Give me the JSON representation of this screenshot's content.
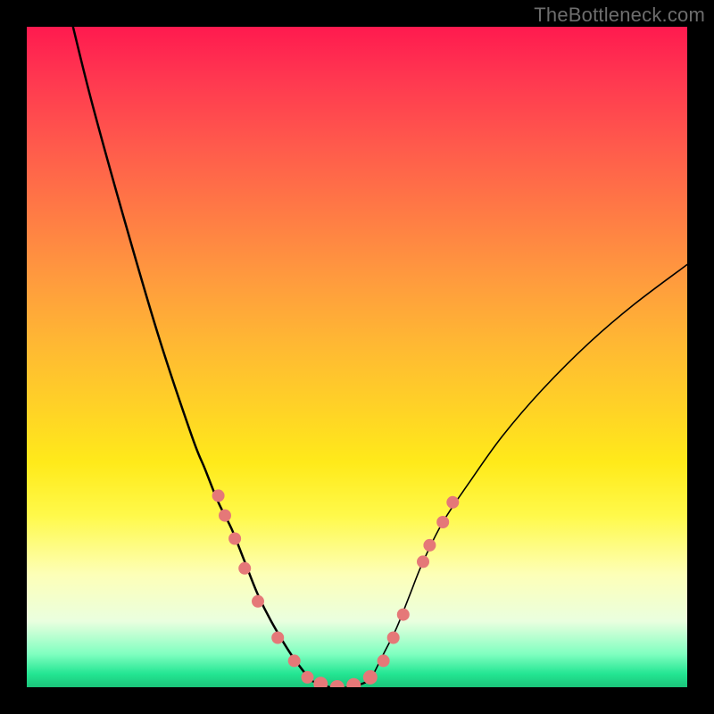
{
  "attribution": "TheBottleneck.com",
  "chart_data": {
    "type": "line",
    "title": "",
    "xlabel": "",
    "ylabel": "",
    "xlim": [
      0,
      100
    ],
    "ylim": [
      0,
      100
    ],
    "grid": false,
    "legend": false,
    "series": [
      {
        "name": "left-branch",
        "x": [
          7,
          10,
          15,
          20,
          25,
          27,
          29,
          31,
          33,
          35,
          37,
          40,
          43
        ],
        "y": [
          100,
          88,
          70,
          53,
          38,
          33,
          28,
          24,
          19,
          14,
          10,
          5,
          1
        ],
        "color": "#000000",
        "width": 2.5
      },
      {
        "name": "right-branch",
        "x": [
          52,
          54,
          56,
          58,
          60,
          63,
          67,
          72,
          78,
          85,
          92,
          100
        ],
        "y": [
          1,
          5,
          9,
          14,
          19,
          25,
          31,
          38,
          45,
          52,
          58,
          64
        ],
        "color": "#000000",
        "width": 1.6
      },
      {
        "name": "floor",
        "x": [
          43,
          46,
          49,
          52
        ],
        "y": [
          1,
          0,
          0,
          1
        ],
        "color": "#000000",
        "width": 2.2
      }
    ],
    "markers": [
      {
        "x": 29.0,
        "y": 29.0,
        "r": 7
      },
      {
        "x": 30.0,
        "y": 26.0,
        "r": 7
      },
      {
        "x": 31.5,
        "y": 22.5,
        "r": 7
      },
      {
        "x": 33.0,
        "y": 18.0,
        "r": 7
      },
      {
        "x": 35.0,
        "y": 13.0,
        "r": 7
      },
      {
        "x": 38.0,
        "y": 7.5,
        "r": 7
      },
      {
        "x": 40.5,
        "y": 4.0,
        "r": 7
      },
      {
        "x": 42.5,
        "y": 1.5,
        "r": 7
      },
      {
        "x": 44.5,
        "y": 0.5,
        "r": 8
      },
      {
        "x": 47.0,
        "y": 0.0,
        "r": 8
      },
      {
        "x": 49.5,
        "y": 0.3,
        "r": 8
      },
      {
        "x": 52.0,
        "y": 1.5,
        "r": 8
      },
      {
        "x": 54.0,
        "y": 4.0,
        "r": 7
      },
      {
        "x": 55.5,
        "y": 7.5,
        "r": 7
      },
      {
        "x": 57.0,
        "y": 11.0,
        "r": 7
      },
      {
        "x": 60.0,
        "y": 19.0,
        "r": 7
      },
      {
        "x": 61.0,
        "y": 21.5,
        "r": 7
      },
      {
        "x": 63.0,
        "y": 25.0,
        "r": 7
      },
      {
        "x": 64.5,
        "y": 28.0,
        "r": 7
      }
    ],
    "marker_color": "#e57878"
  }
}
